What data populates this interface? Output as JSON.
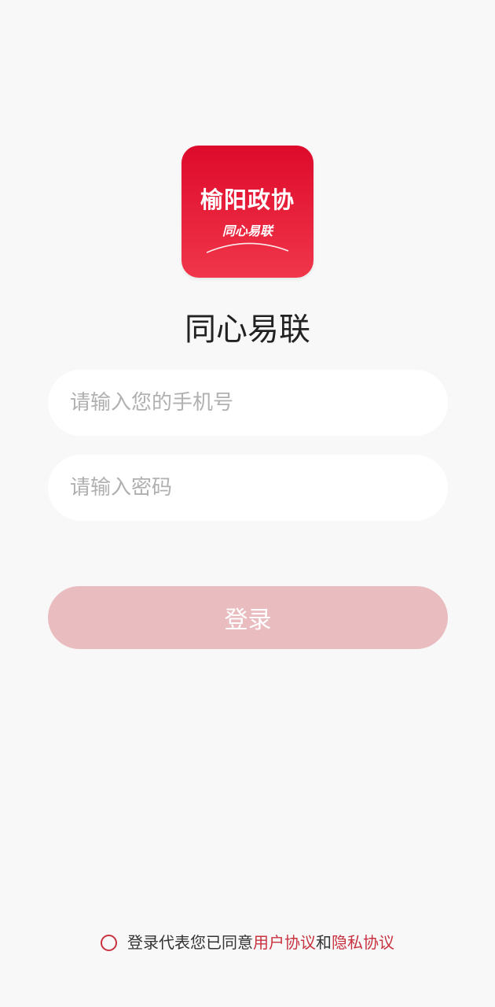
{
  "logo": {
    "main_text": "榆阳政协",
    "sub_text": "同心易联"
  },
  "app_title": "同心易联",
  "form": {
    "phone_placeholder": "请输入您的手机号",
    "password_placeholder": "请输入密码",
    "login_label": "登录"
  },
  "agreement": {
    "prefix": "登录代表您已同意",
    "user_agreement": "用户协议",
    "conjunction": "和",
    "privacy_agreement": "隐私协议"
  },
  "colors": {
    "logo_gradient_top": "#de0a2b",
    "logo_gradient_bottom": "#f0364a",
    "login_button": "#e9bcbf",
    "link": "#c8323f",
    "background": "#f8f8f8"
  }
}
